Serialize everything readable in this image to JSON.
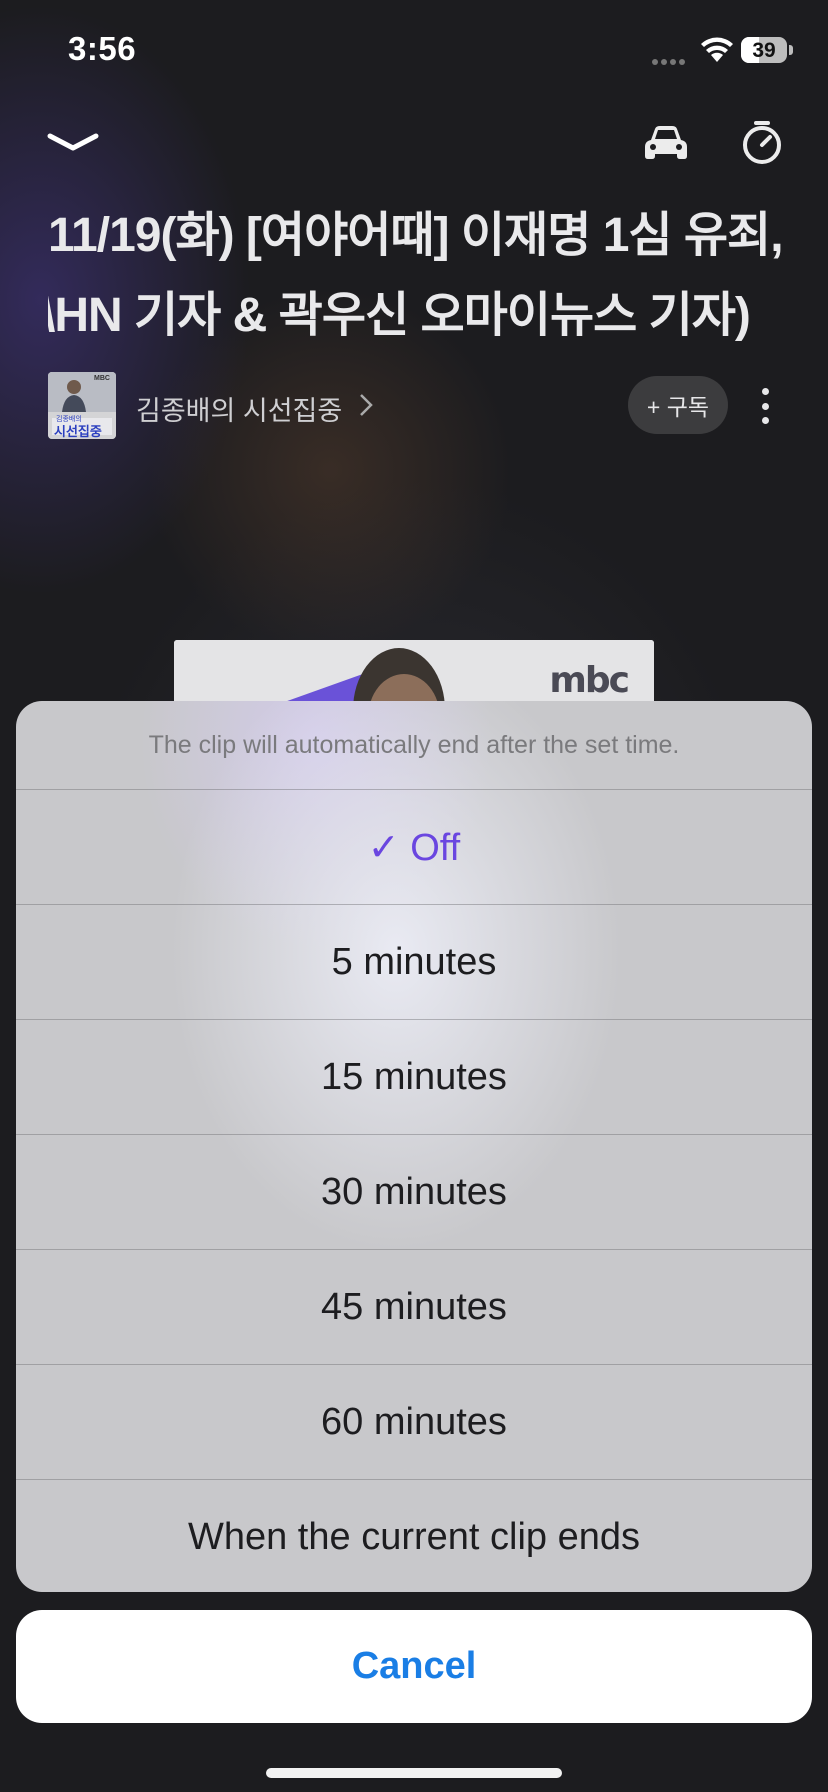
{
  "status": {
    "time": "3:56",
    "battery": "39"
  },
  "header": {
    "collapse_icon": "chevron-down-icon",
    "car_icon": "car-icon",
    "timer_icon": "sleep-timer-icon"
  },
  "episode": {
    "title_line1": "11/19(화) [여야어때] 이재명 1심 유죄,",
    "title_line2": "\\HN 기자 & 곽우신 오마이뉴스 기자)"
  },
  "channel": {
    "thumb_brand": "MBC",
    "thumb_caption_small": "김종배의",
    "thumb_caption": "시선집중",
    "name": "김종배의 시선집중",
    "subscribe_label": "+ 구독"
  },
  "artwork": {
    "logo": "mbc"
  },
  "sleep_sheet": {
    "header": "The clip will automatically end after the set time.",
    "options": [
      {
        "label": "✓ Off",
        "selected": true
      },
      {
        "label": "5 minutes",
        "selected": false
      },
      {
        "label": "15 minutes",
        "selected": false
      },
      {
        "label": "30 minutes",
        "selected": false
      },
      {
        "label": "45 minutes",
        "selected": false
      },
      {
        "label": "60 minutes",
        "selected": false
      },
      {
        "label": "When the current clip ends",
        "selected": false
      }
    ],
    "cancel_label": "Cancel"
  },
  "colors": {
    "accent": "#6a46e0",
    "cancel": "#1a7ee5"
  }
}
